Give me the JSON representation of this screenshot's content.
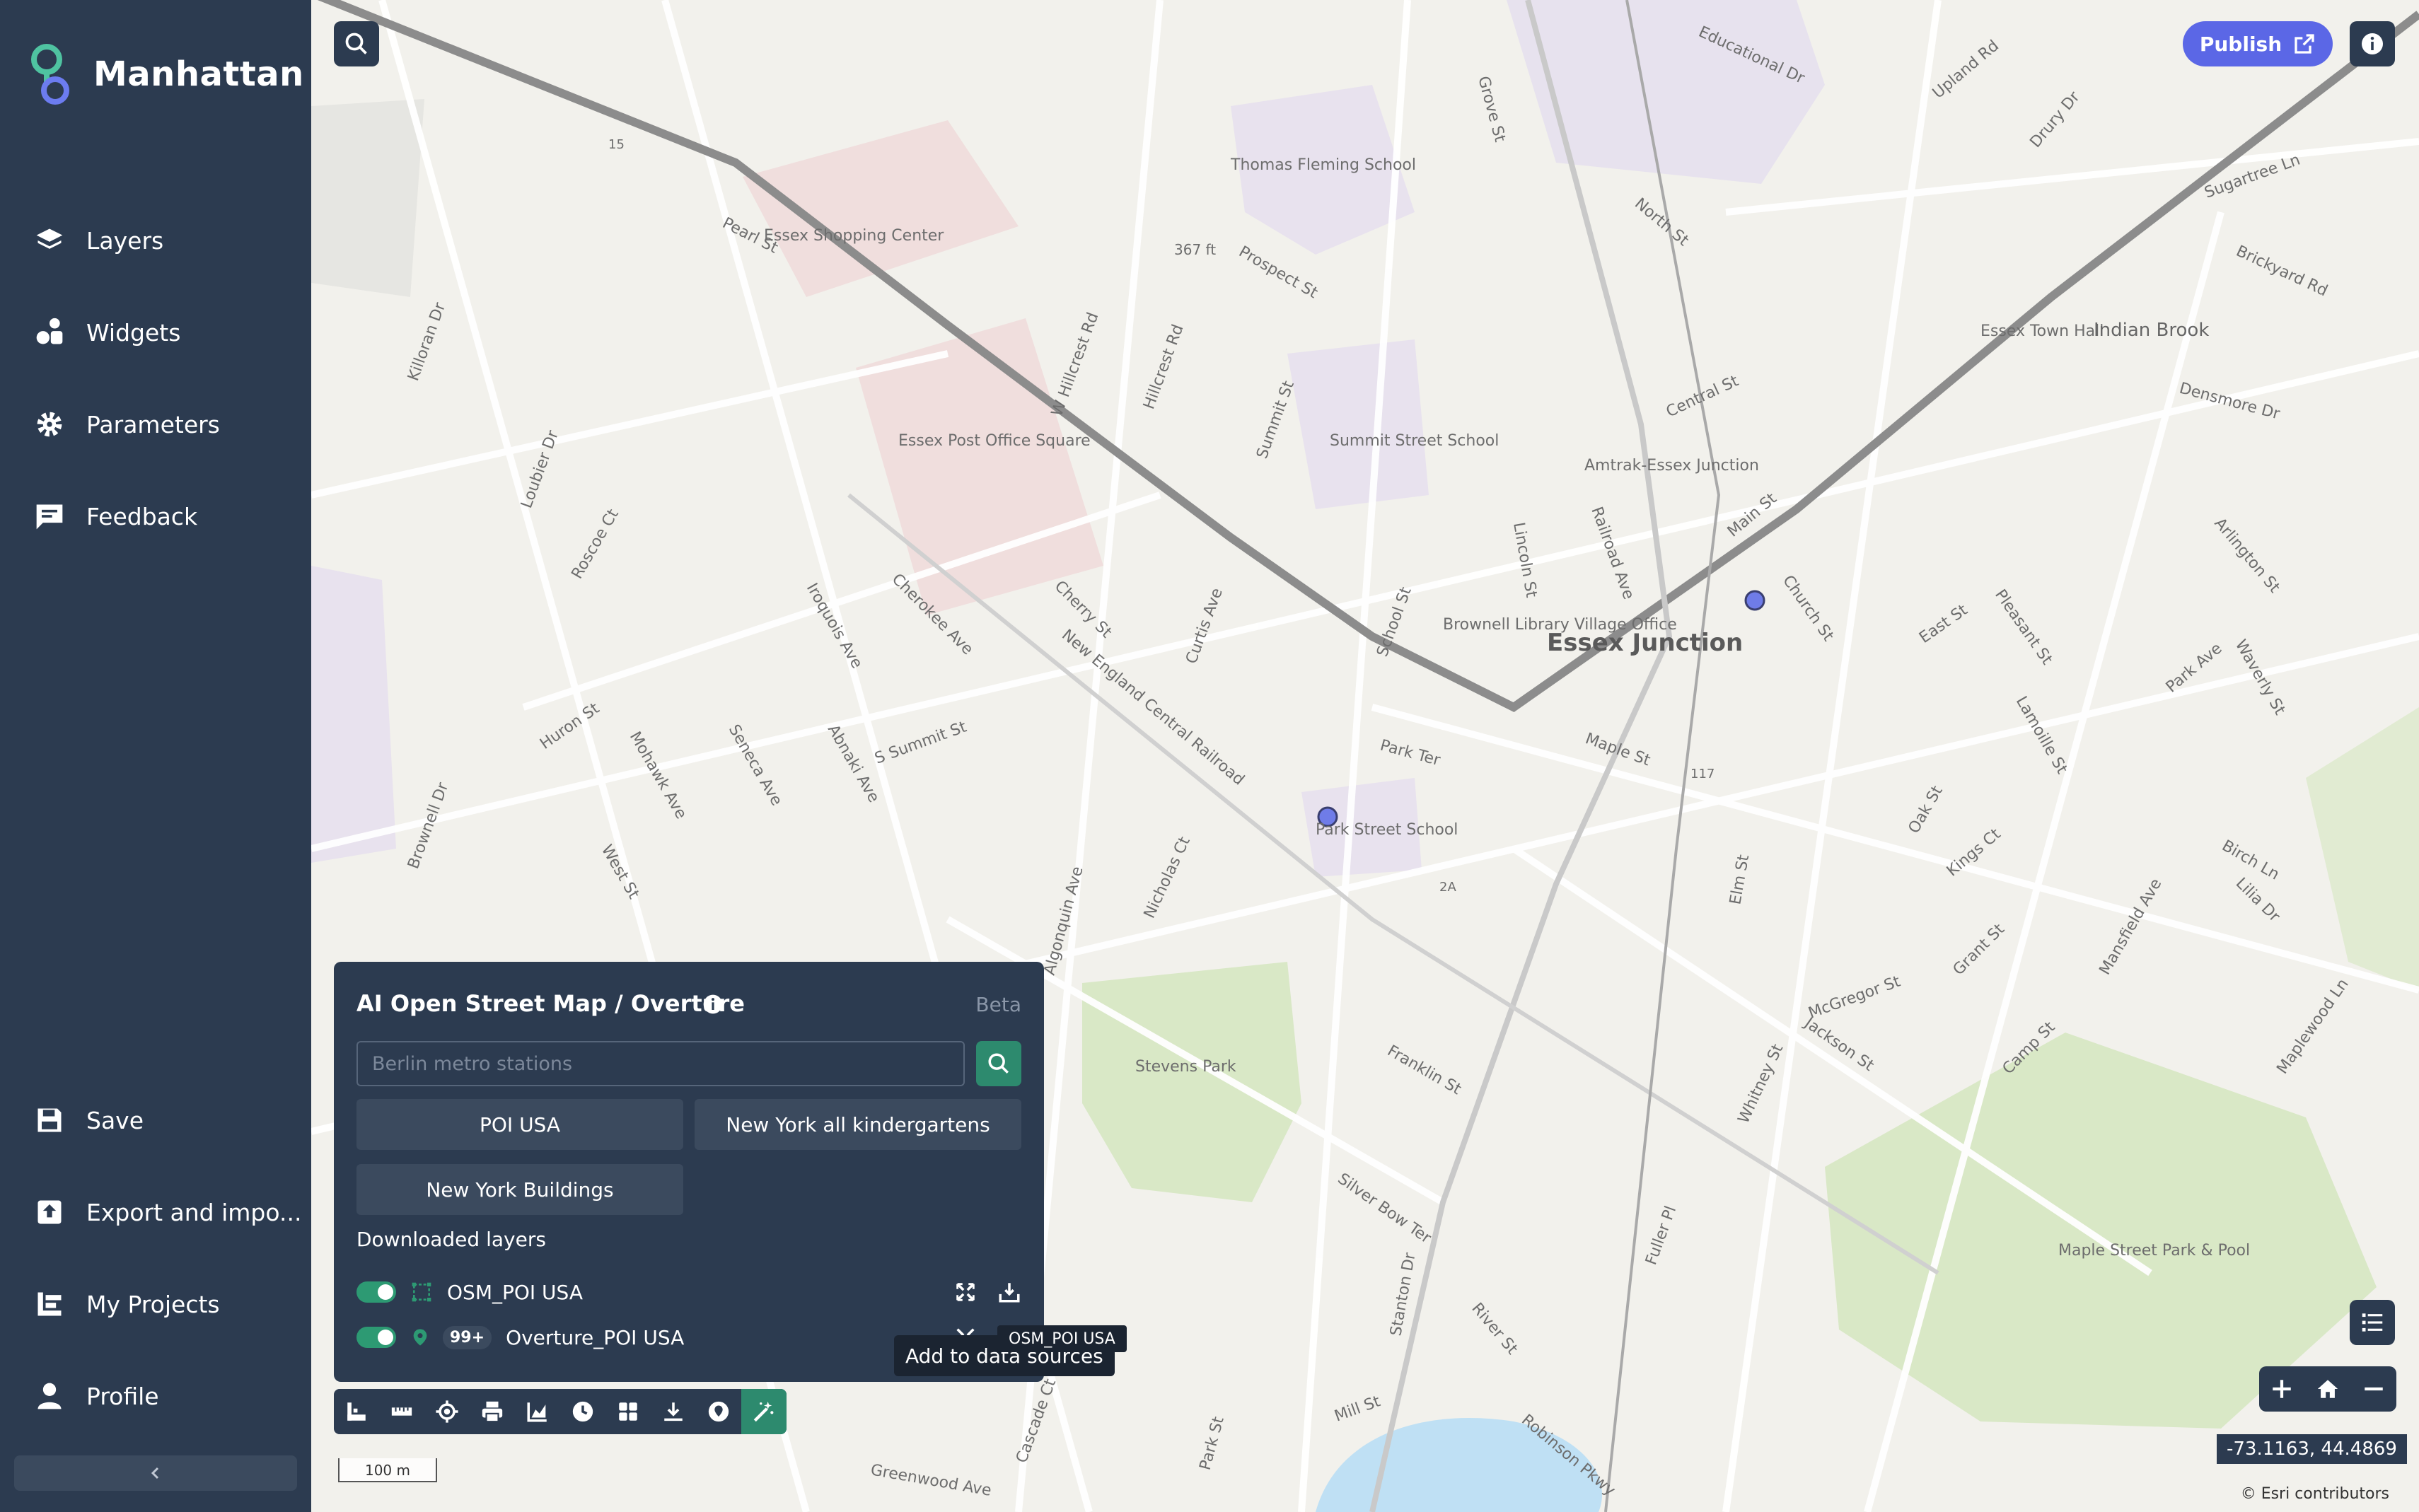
{
  "app": {
    "name": "Manhattan",
    "brand_color": "#2c3b50",
    "accent_color": "#2d8a6e",
    "publish_color": "#5b67e6"
  },
  "sidebar": {
    "top_items": [
      {
        "label": "Layers",
        "icon": "layers-icon"
      },
      {
        "label": "Widgets",
        "icon": "widgets-icon"
      },
      {
        "label": "Parameters",
        "icon": "gear-icon"
      },
      {
        "label": "Feedback",
        "icon": "feedback-icon"
      }
    ],
    "bottom_items": [
      {
        "label": "Save",
        "icon": "save-icon"
      },
      {
        "label": "Export and impo...",
        "icon": "export-icon"
      },
      {
        "label": "My Projects",
        "icon": "projects-icon"
      },
      {
        "label": "Profile",
        "icon": "user-icon"
      }
    ],
    "collapse_icon": "chevron-left-icon"
  },
  "header": {
    "publish_label": "Publish"
  },
  "map": {
    "place_labels": [
      "Essex Junction",
      "Essex Shopping Center",
      "Essex Post Office Square",
      "Thomas Fleming School",
      "Summit Street School",
      "Brownell Library Village Office",
      "Amtrak-Essex Junction",
      "Park Street School",
      "Stevens Park",
      "Maple Street Park & Pool",
      "Essex Town Hall",
      "Indian Brook",
      "Educational Dr",
      "Pearl St",
      "Main St",
      "Park Ter",
      "Maple St",
      "Franklin St",
      "Church St",
      "Prospect St",
      "Central St",
      "School St",
      "Railroad Ave",
      "East St",
      "Pleasant St",
      "Lincoln St",
      "Grove St",
      "North St",
      "Upland Rd",
      "Drury Dr",
      "Sugartree Ln",
      "Brickyard Rd",
      "Densmore Dr",
      "Arlington St",
      "Park Ave",
      "Waverly St",
      "Lamoille St",
      "Oak St",
      "Kings Ct",
      "Birch Ln",
      "Lilia Dr",
      "Mansfield Ave",
      "Maplewood Ln",
      "Grant St",
      "McGregor St",
      "Jackson St",
      "Camp St",
      "Whitney St",
      "Elm St",
      "Fuller Pl",
      "Silver Bow Ter",
      "Stanton Dr",
      "River St",
      "Mill St",
      "Robinson Pkwy",
      "Greenwood Ave",
      "Cascade Ct",
      "Park St",
      "Nicholas Ct",
      "Algonquin Ave",
      "S Summit St",
      "Abnaki Ave",
      "Seneca Ave",
      "Mohawk Ave",
      "Huron St",
      "West St",
      "Brownell Dr",
      "Iroquois Ave",
      "Cherokee Ave",
      "Cherry St",
      "Curtis Ave",
      "W Hillcrest Rd",
      "Hillcrest Rd",
      "Summit St",
      "Killoran Dr",
      "Loubier Dr",
      "Roscoe Ct",
      "New England Central Railroad",
      "367 ft",
      "15",
      "117",
      "2A"
    ],
    "markers": 2,
    "scale_label": "100 m",
    "coordinates": "-73.1163, 44.4869",
    "attribution": "© Esri contributors"
  },
  "ai_panel": {
    "title": "AI Open Street Map / Overture",
    "beta_label": "Beta",
    "search_placeholder": "Berlin metro stations",
    "presets": [
      "POI USA",
      "New York all kindergartens",
      "New York Buildings"
    ],
    "downloaded_title": "Downloaded layers",
    "layers": [
      {
        "name": "OSM_POI USA",
        "enabled": true,
        "icon": "polygon-icon",
        "badge": ""
      },
      {
        "name": "Overture_POI USA",
        "enabled": true,
        "icon": "pin-icon",
        "badge": "99+"
      }
    ]
  },
  "toolbar": {
    "tools": [
      "basemap-icon",
      "ruler-icon",
      "locate-icon",
      "print-icon",
      "chart-icon",
      "clock-icon",
      "grid-icon",
      "download-icon",
      "pin-circle-icon",
      "magic-wand-icon"
    ],
    "active_tool": "magic-wand-icon"
  },
  "tooltips": {
    "layer_name": "OSM_POI USA",
    "action": "Add to data sources"
  }
}
